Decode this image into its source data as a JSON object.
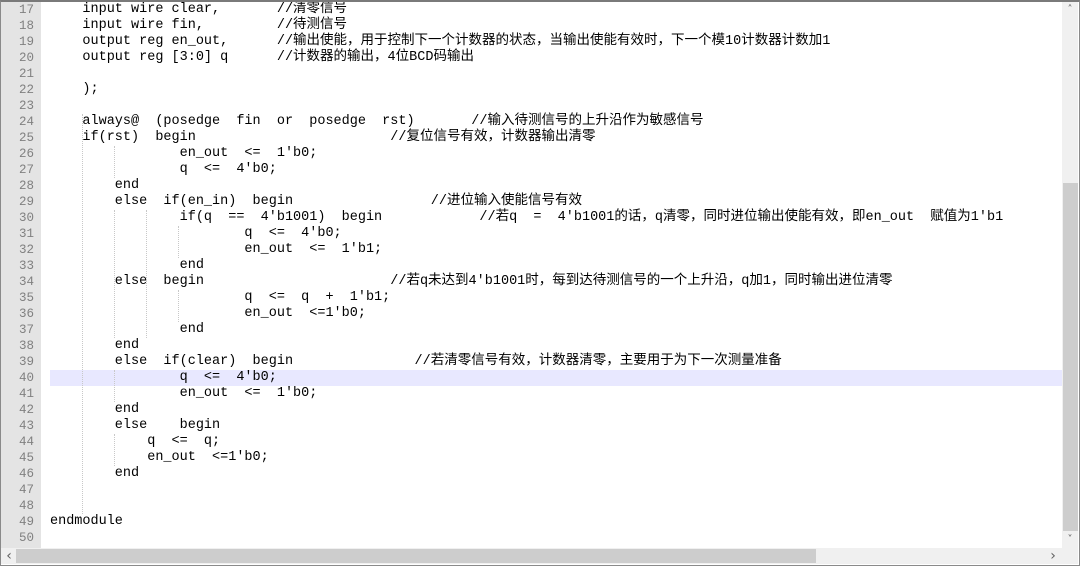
{
  "editor": {
    "current_line": 40,
    "lines": [
      {
        "num": "17",
        "text": "    input wire clear,       //清零信号"
      },
      {
        "num": "18",
        "text": "    input wire fin,         //待测信号"
      },
      {
        "num": "19",
        "text": "    output reg en_out,      //输出使能，用于控制下一个计数器的状态，当输出使能有效时，下一个模10计数器计数加1"
      },
      {
        "num": "20",
        "text": "    output reg [3:0] q      //计数器的输出，4位BCD码输出"
      },
      {
        "num": "21",
        "text": ""
      },
      {
        "num": "22",
        "text": "    );"
      },
      {
        "num": "23",
        "text": ""
      },
      {
        "num": "24",
        "text": "    always@  (posedge  fin  or  posedge  rst)       //输入待测信号的上升沿作为敏感信号"
      },
      {
        "num": "25",
        "text": "    if(rst)  begin                        //复位信号有效，计数器输出清零"
      },
      {
        "num": "26",
        "text": "                en_out  <=  1'b0;"
      },
      {
        "num": "27",
        "text": "                q  <=  4'b0;"
      },
      {
        "num": "28",
        "text": "        end"
      },
      {
        "num": "29",
        "text": "        else  if(en_in)  begin                 //进位输入使能信号有效"
      },
      {
        "num": "30",
        "text": "                if(q  ==  4'b1001)  begin            //若q  =  4'b1001的话，q清零，同时进位输出使能有效，即en_out  赋值为1'b1"
      },
      {
        "num": "31",
        "text": "                        q  <=  4'b0;"
      },
      {
        "num": "32",
        "text": "                        en_out  <=  1'b1;"
      },
      {
        "num": "33",
        "text": "                end"
      },
      {
        "num": "34",
        "text": "        else  begin                       //若q未达到4'b1001时，每到达待测信号的一个上升沿，q加1，同时输出进位清零"
      },
      {
        "num": "35",
        "text": "                        q  <=  q  +  1'b1;"
      },
      {
        "num": "36",
        "text": "                        en_out  <=1'b0;"
      },
      {
        "num": "37",
        "text": "                end"
      },
      {
        "num": "38",
        "text": "        end"
      },
      {
        "num": "39",
        "text": "        else  if(clear)  begin               //若清零信号有效，计数器清零，主要用于为下一次测量准备"
      },
      {
        "num": "40",
        "text": "                q  <=  4'b0;"
      },
      {
        "num": "41",
        "text": "                en_out  <=  1'b0;"
      },
      {
        "num": "42",
        "text": "        end"
      },
      {
        "num": "43",
        "text": "        else    begin"
      },
      {
        "num": "44",
        "text": "            q  <=  q;"
      },
      {
        "num": "45",
        "text": "            en_out  <=1'b0;"
      },
      {
        "num": "46",
        "text": "        end"
      },
      {
        "num": "47",
        "text": ""
      },
      {
        "num": "48",
        "text": ""
      },
      {
        "num": "49",
        "text": "endmodule"
      },
      {
        "num": "50",
        "text": ""
      }
    ]
  },
  "scrollbars": {
    "up_arrow": "˄",
    "down_arrow": "˅",
    "left_arrow": "‹",
    "right_arrow": "›"
  }
}
